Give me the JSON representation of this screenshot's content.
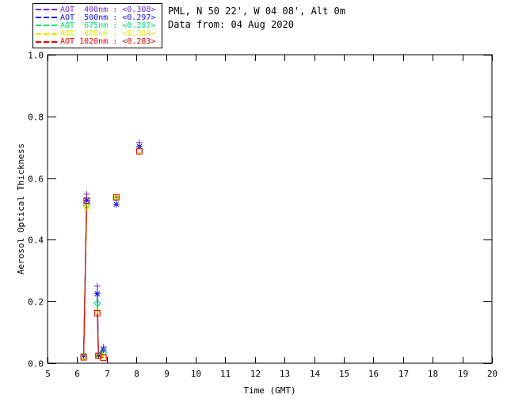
{
  "header": {
    "site_line": "PML, N 50 22', W 04 08', Alt 0m",
    "date_line": "Data from: 04 Aug 2020"
  },
  "chart_data": {
    "type": "line",
    "xlabel": "Time (GMT)",
    "ylabel": "Aerosol Optical Thickness",
    "xlim": [
      5,
      20
    ],
    "ylim": [
      0.0,
      1.0
    ],
    "xticks": [
      5,
      6,
      7,
      8,
      9,
      10,
      11,
      12,
      13,
      14,
      15,
      16,
      17,
      18,
      19,
      20
    ],
    "ytick_labels": [
      "0.0",
      "0.2",
      "0.4",
      "0.6",
      "0.8",
      "1.0"
    ],
    "grid": false,
    "legend_position": "top-left-outside",
    "x_hours_gmt": [
      6.22,
      6.32,
      6.68,
      6.72,
      6.89,
      7.32,
      8.1
    ],
    "connected_runs": [
      [
        0,
        1
      ],
      [
        2,
        3,
        4
      ]
    ],
    "series": [
      {
        "name": "AOT 400nm",
        "legend_label": "AOT  400nm : <0.308>",
        "mean_aot": "<0.308>",
        "color": "#7129D1",
        "marker": "plus",
        "values": [
          0.028,
          0.548,
          0.25,
          0.028,
          0.052,
          0.537,
          0.715
        ]
      },
      {
        "name": "AOT 500nm",
        "legend_label": "AOT  500nm : <0.297>",
        "mean_aot": "<0.297>",
        "color": "#1111E8",
        "marker": "asterisk",
        "values": [
          0.025,
          0.528,
          0.225,
          0.026,
          0.043,
          0.515,
          0.702
        ]
      },
      {
        "name": "AOT 675nm",
        "legend_label": "AOT  675nm : <0.287>",
        "mean_aot": "<0.287>",
        "color": "#00DC73",
        "marker": "diamond",
        "values": [
          0.022,
          0.511,
          0.194,
          0.024,
          0.035,
          0.535,
          0.69
        ]
      },
      {
        "name": "AOT 870nm",
        "legend_label": "AOT  870nm : <0.284>",
        "mean_aot": "<0.284>",
        "color": "#E6E600",
        "marker": "square-small",
        "values": [
          0.02,
          0.506,
          0.168,
          0.023,
          0.023,
          0.538,
          0.689
        ]
      },
      {
        "name": "AOT 1020nm",
        "legend_label": "AOT 1020nm : <0.283>",
        "mean_aot": "<0.283>",
        "color": "#E80000",
        "marker": "square",
        "values": [
          0.019,
          0.527,
          0.162,
          0.024,
          0.018,
          0.538,
          0.687
        ]
      }
    ]
  }
}
